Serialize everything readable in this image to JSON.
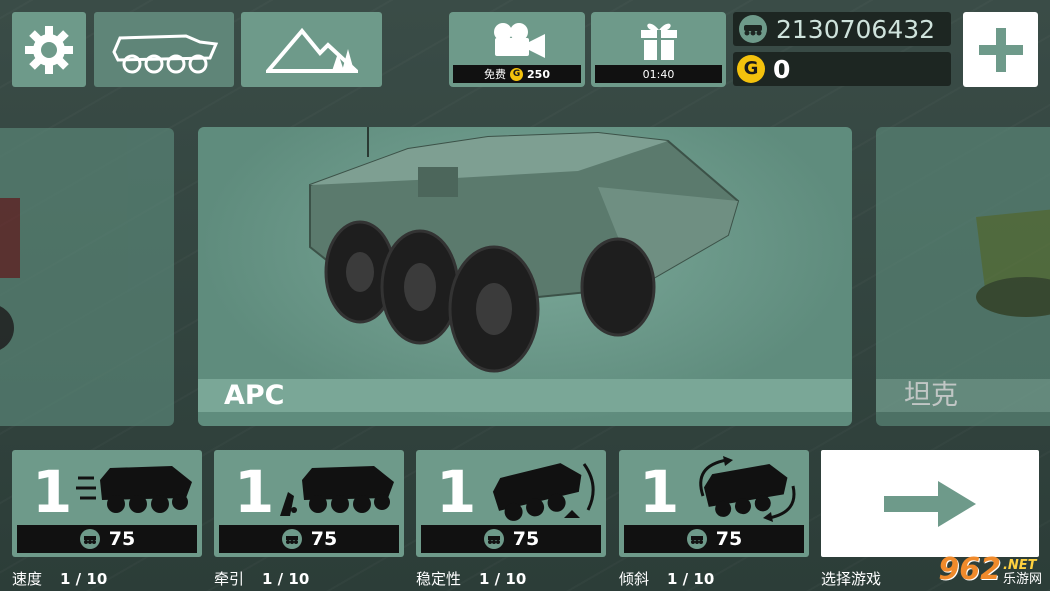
{
  "top_bar": {
    "settings_icon": "gear-icon",
    "vehicle_icon": "apc-outline-icon",
    "terrain_icon": "mountain-icon",
    "video_reward": {
      "icon": "film-camera-icon",
      "label": "免费",
      "amount": "250"
    },
    "gift": {
      "icon": "gift-icon",
      "timer": "01:40"
    },
    "tokens": {
      "icon": "tank-token-icon",
      "value": "2130706432"
    },
    "coins": {
      "icon": "coin-icon",
      "symbol": "G",
      "value": "0"
    },
    "add_icon": "plus-icon"
  },
  "vehicles": {
    "left_label": "",
    "main_label": "APC",
    "right_label": "坦克"
  },
  "stats": [
    {
      "level": "1",
      "cost": "75",
      "name": "速度",
      "progress": "1 / 10",
      "icon": "apc-speed-icon"
    },
    {
      "level": "1",
      "cost": "75",
      "name": "牵引",
      "progress": "1 / 10",
      "icon": "apc-traction-icon"
    },
    {
      "level": "1",
      "cost": "75",
      "name": "稳定性",
      "progress": "1 / 10",
      "icon": "apc-stability-icon"
    },
    {
      "level": "1",
      "cost": "75",
      "name": "倾斜",
      "progress": "1 / 10",
      "icon": "apc-tilt-icon"
    }
  ],
  "go": {
    "label": "选择游戏",
    "icon": "arrow-right-icon"
  },
  "watermark": {
    "number": "962",
    "dot_net": ".NET",
    "site": "乐游网"
  },
  "colors": {
    "panel": "#6e9a8a",
    "background": "#2e3f3a",
    "coin": "#f4c20d"
  }
}
